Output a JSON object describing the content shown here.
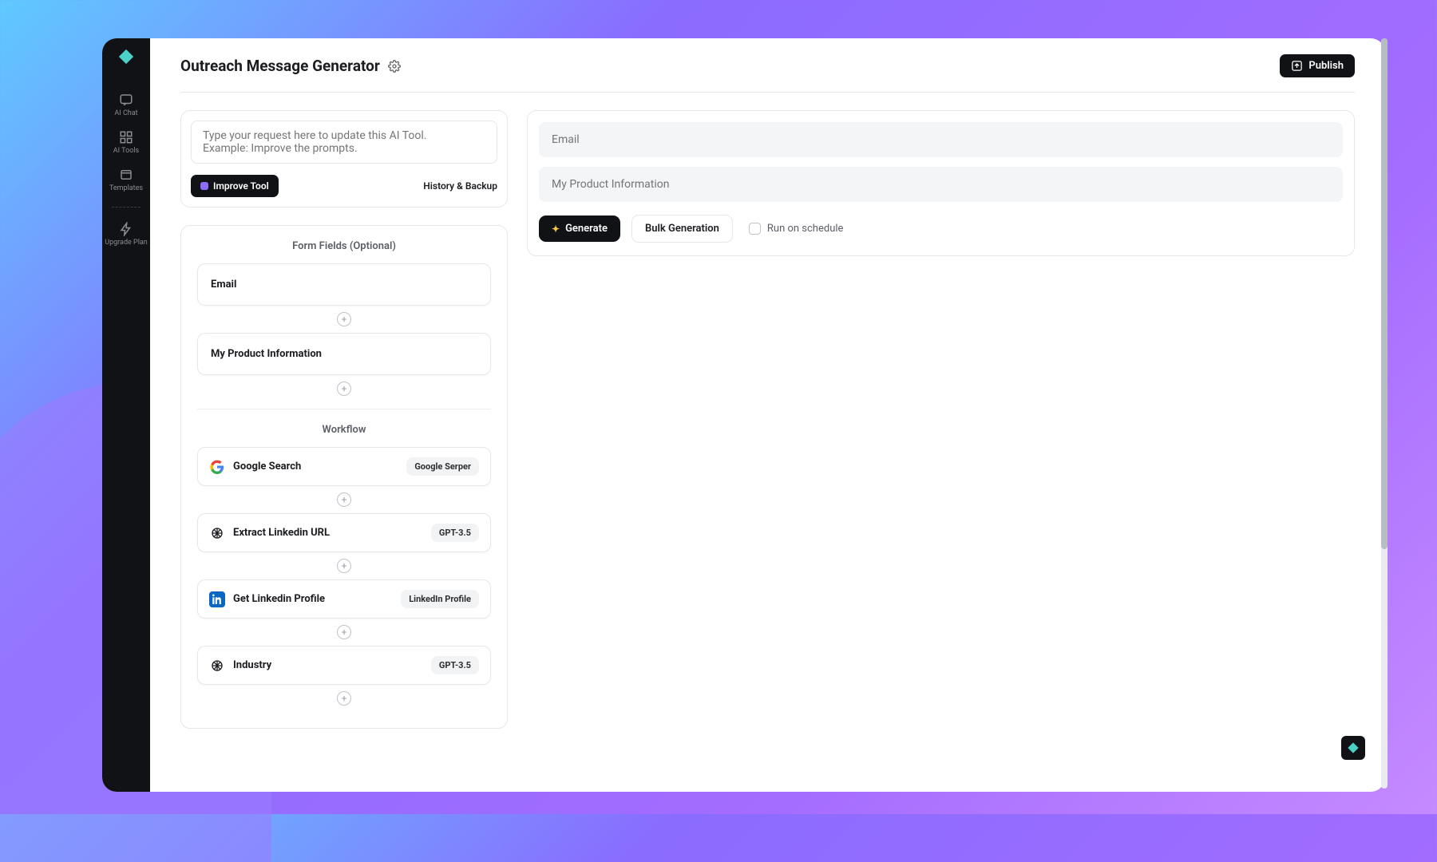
{
  "sidebar": {
    "items": [
      {
        "label": "AI Chat"
      },
      {
        "label": "AI Tools"
      },
      {
        "label": "Templates"
      },
      {
        "label": "Upgrade Plan"
      }
    ]
  },
  "header": {
    "title": "Outreach Message Generator",
    "publish_label": "Publish"
  },
  "prompt": {
    "placeholder": "Type your request here to update this AI Tool.\nExample: Improve the prompts.",
    "improve_label": "Improve Tool",
    "history_label": "History & Backup"
  },
  "form_section": {
    "title": "Form Fields (Optional)",
    "fields": [
      {
        "label": "Email"
      },
      {
        "label": "My Product Information"
      }
    ]
  },
  "workflow_section": {
    "title": "Workflow",
    "steps": [
      {
        "title": "Google Search",
        "badge": "Google Serper",
        "icon": "google"
      },
      {
        "title": "Extract Linkedin URL",
        "badge": "GPT-3.5",
        "icon": "openai"
      },
      {
        "title": "Get Linkedin Profile",
        "badge": "LinkedIn Profile",
        "icon": "linkedin"
      },
      {
        "title": "Industry",
        "badge": "GPT-3.5",
        "icon": "openai"
      }
    ]
  },
  "right": {
    "email_placeholder": "Email",
    "product_placeholder": "My Product Information",
    "generate_label": "Generate",
    "bulk_label": "Bulk Generation",
    "schedule_label": "Run on schedule"
  }
}
